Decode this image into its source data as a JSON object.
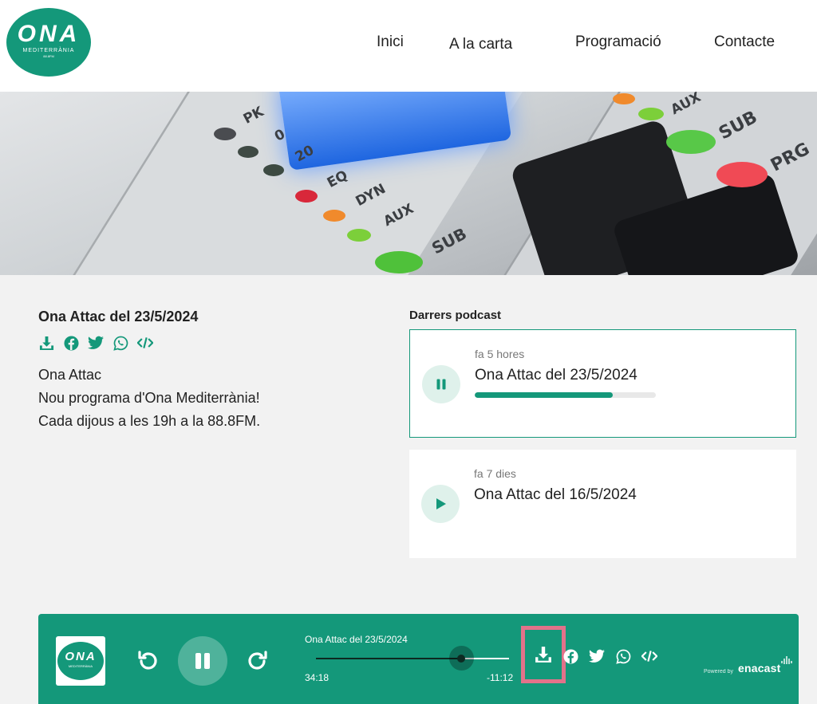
{
  "brand": {
    "logo_text": "ONA",
    "logo_sub": "MEDITERRÀNIA",
    "logo_freq": "88.8FM"
  },
  "nav": {
    "items": [
      "Inici",
      "A la carta",
      "Programació",
      "Contacte"
    ]
  },
  "hero": {
    "labels": [
      "PK",
      "0",
      "20",
      "EQ",
      "DYN",
      "AUX",
      "SUB",
      "AUX",
      "SUB",
      "PRG"
    ]
  },
  "episode": {
    "title": "Ona Attac del 23/5/2024",
    "icons": [
      "download-icon",
      "facebook-icon",
      "twitter-icon",
      "whatsapp-icon",
      "embed-code-icon"
    ],
    "description": [
      "Ona Attac",
      "Nou programa d'Ona Mediterrània!",
      "Cada dijous a les 19h a la 88.8FM."
    ]
  },
  "podcasts": {
    "heading": "Darrers podcast",
    "items": [
      {
        "ago": "fa 5 hores",
        "title": "Ona Attac del 23/5/2024",
        "state": "playing",
        "progress": 0.76
      },
      {
        "ago": "fa 7 dies",
        "title": "Ona Attac del 16/5/2024",
        "state": "paused"
      }
    ]
  },
  "player": {
    "title": "Ona Attac del 23/5/2024",
    "elapsed": "34:18",
    "remaining": "-11:12",
    "progress": 0.75,
    "state": "playing",
    "powered_by": "Powered by",
    "provider": "enacast"
  },
  "colors": {
    "accent": "#14987a",
    "accent_light": "#dff1eb",
    "highlight_box": "#e2728a"
  }
}
